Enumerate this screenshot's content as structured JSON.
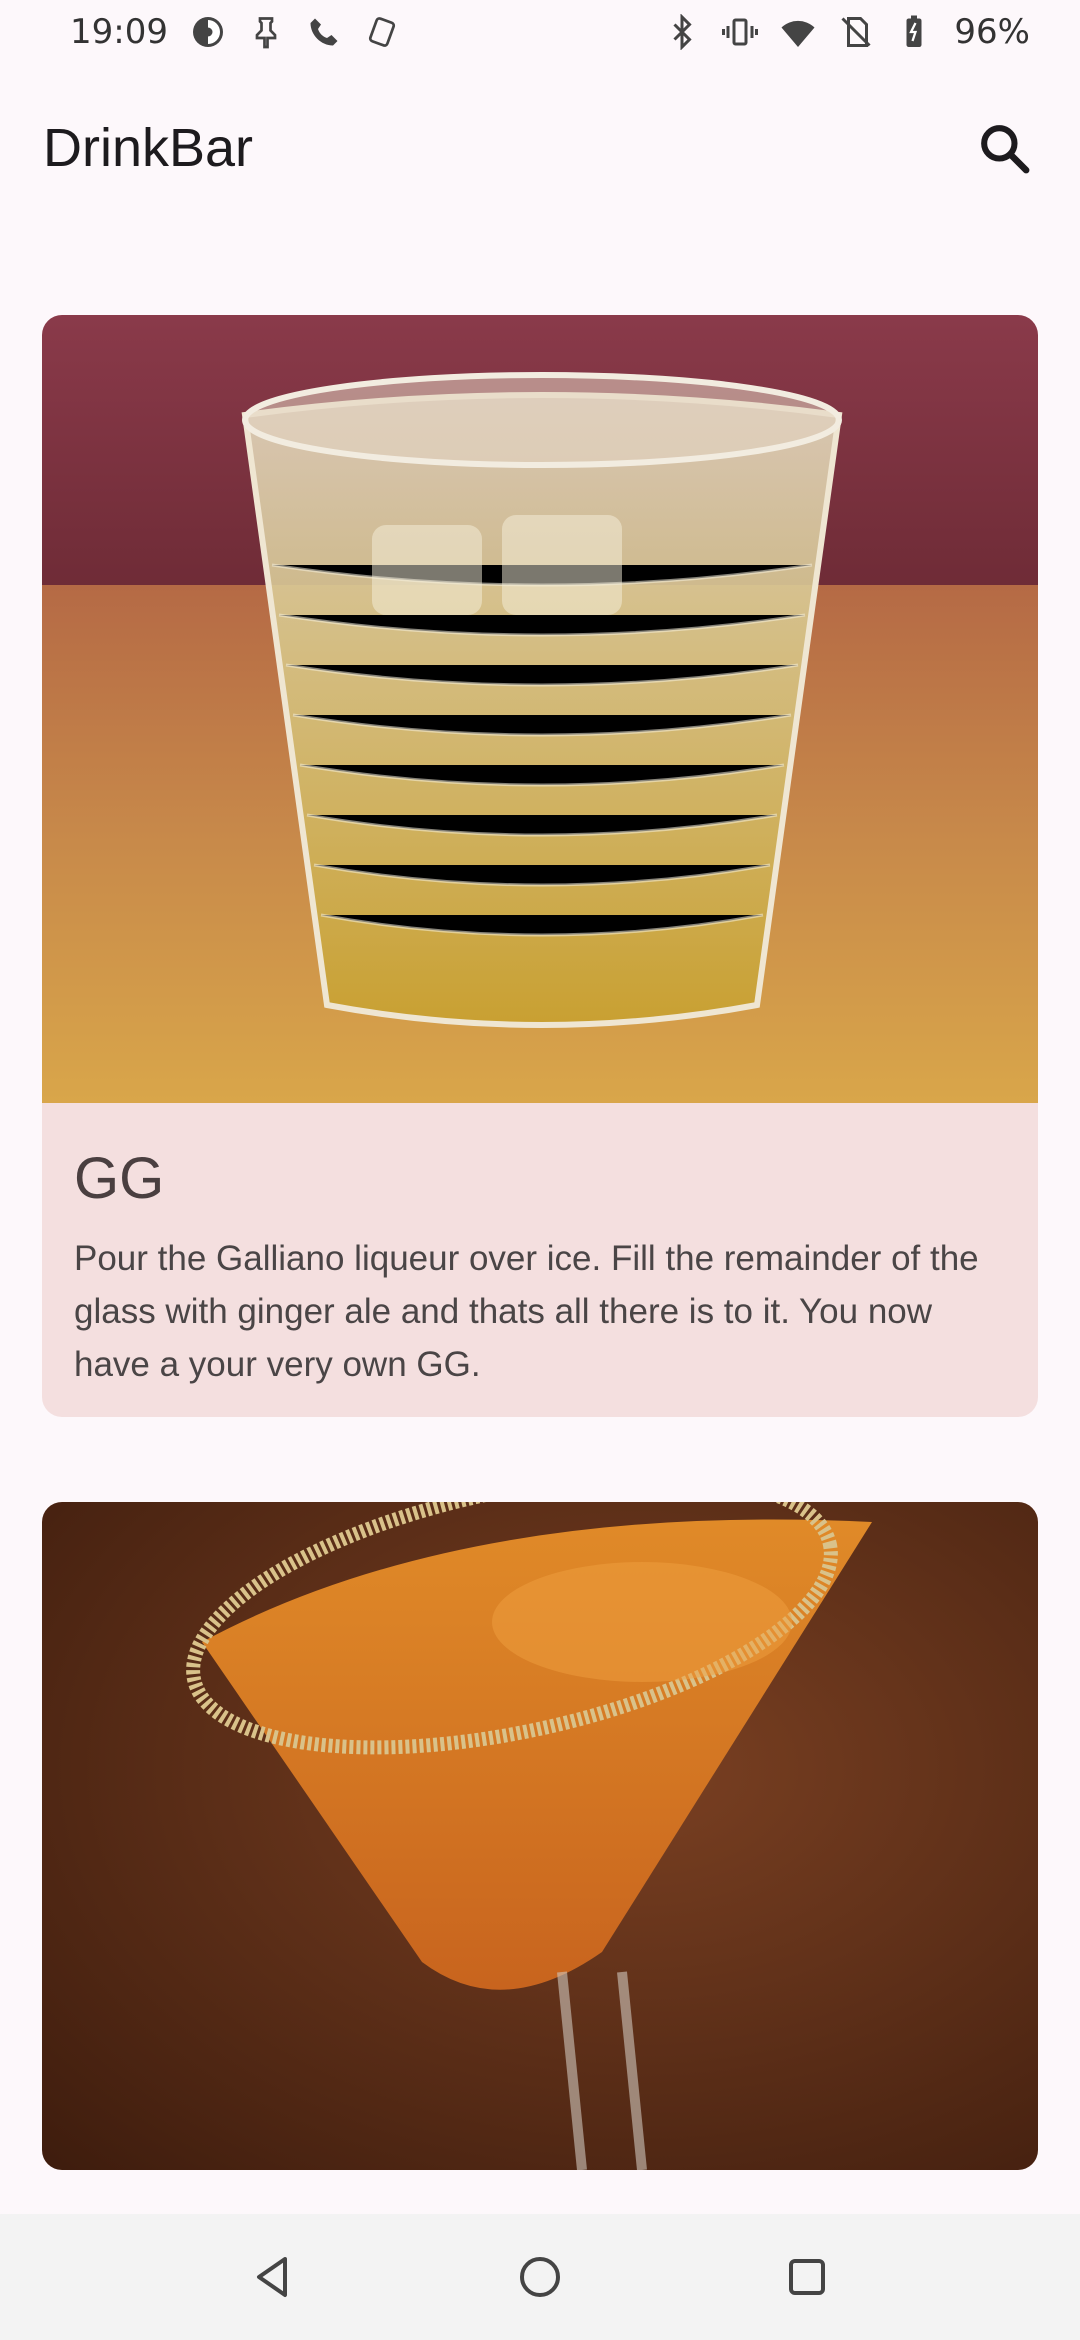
{
  "status_bar": {
    "time": "19:09",
    "battery": "96%",
    "icons_left": [
      "data-saver-icon",
      "pin-icon",
      "phone-icon",
      "screen-rotate-icon"
    ],
    "icons_right": [
      "bluetooth-icon",
      "vibrate-icon",
      "wifi-icon",
      "no-sim-icon",
      "battery-icon"
    ]
  },
  "app_bar": {
    "title": "DrinkBar",
    "search_icon": "search-icon"
  },
  "drinks": [
    {
      "name": "GG",
      "description": "Pour the Galliano liqueur over ice. Fill the remainder of the glass with ginger ale and thats all there is to it. You now have a your very own GG.",
      "image": "glass-on-rocks-photo"
    },
    {
      "name": "",
      "description": "",
      "image": "cocktail-sugar-rim-photo"
    }
  ],
  "nav_bar": {
    "back_icon": "back-icon",
    "home_icon": "home-icon",
    "recents_icon": "recents-icon"
  },
  "colors": {
    "background": "#fdf8fb",
    "card": "#f4dfdf",
    "nav_bar": "#f3f3f3"
  }
}
